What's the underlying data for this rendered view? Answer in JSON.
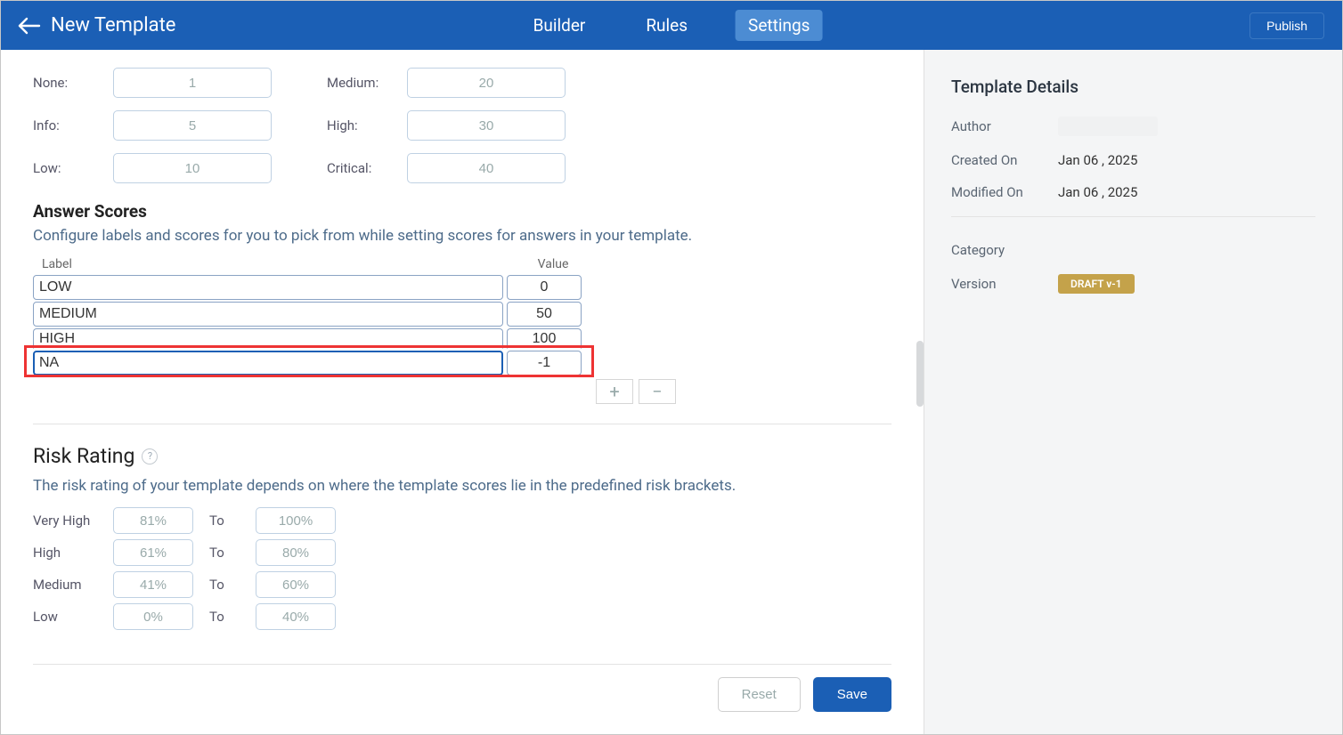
{
  "header": {
    "title": "New Template",
    "tabs": {
      "builder": "Builder",
      "rules": "Rules",
      "settings": "Settings"
    },
    "active_tab": "settings",
    "publish": "Publish"
  },
  "weights": {
    "none": {
      "label": "None:",
      "value": "1"
    },
    "info": {
      "label": "Info:",
      "value": "5"
    },
    "low": {
      "label": "Low:",
      "value": "10"
    },
    "medium": {
      "label": "Medium:",
      "value": "20"
    },
    "high": {
      "label": "High:",
      "value": "30"
    },
    "critical": {
      "label": "Critical:",
      "value": "40"
    }
  },
  "answer_scores": {
    "title": "Answer Scores",
    "desc": "Configure labels and scores for you to pick from while setting scores for answers in your template.",
    "col_label": "Label",
    "col_value": "Value",
    "rows": [
      {
        "label": "LOW",
        "value": "0"
      },
      {
        "label": "MEDIUM",
        "value": "50"
      },
      {
        "label": "HIGH",
        "value": "100"
      },
      {
        "label": "NA",
        "value": "-1"
      }
    ],
    "plus": "+",
    "minus": "−"
  },
  "risk_rating": {
    "title": "Risk Rating",
    "desc": "The risk rating of your template depends on where the template scores lie in the predefined risk brackets.",
    "to": "To",
    "rows": [
      {
        "label": "Very High",
        "from": "81%",
        "to": "100%"
      },
      {
        "label": "High",
        "from": "61%",
        "to": "80%"
      },
      {
        "label": "Medium",
        "from": "41%",
        "to": "60%"
      },
      {
        "label": "Low",
        "from": "0%",
        "to": "40%"
      }
    ]
  },
  "footer": {
    "reset": "Reset",
    "save": "Save"
  },
  "sidebar": {
    "title": "Template Details",
    "author_label": "Author",
    "created_label": "Created On",
    "created_value": "Jan 06 , 2025",
    "modified_label": "Modified On",
    "modified_value": "Jan 06 , 2025",
    "category_label": "Category",
    "version_label": "Version",
    "version_badge": "DRAFT v-1"
  }
}
